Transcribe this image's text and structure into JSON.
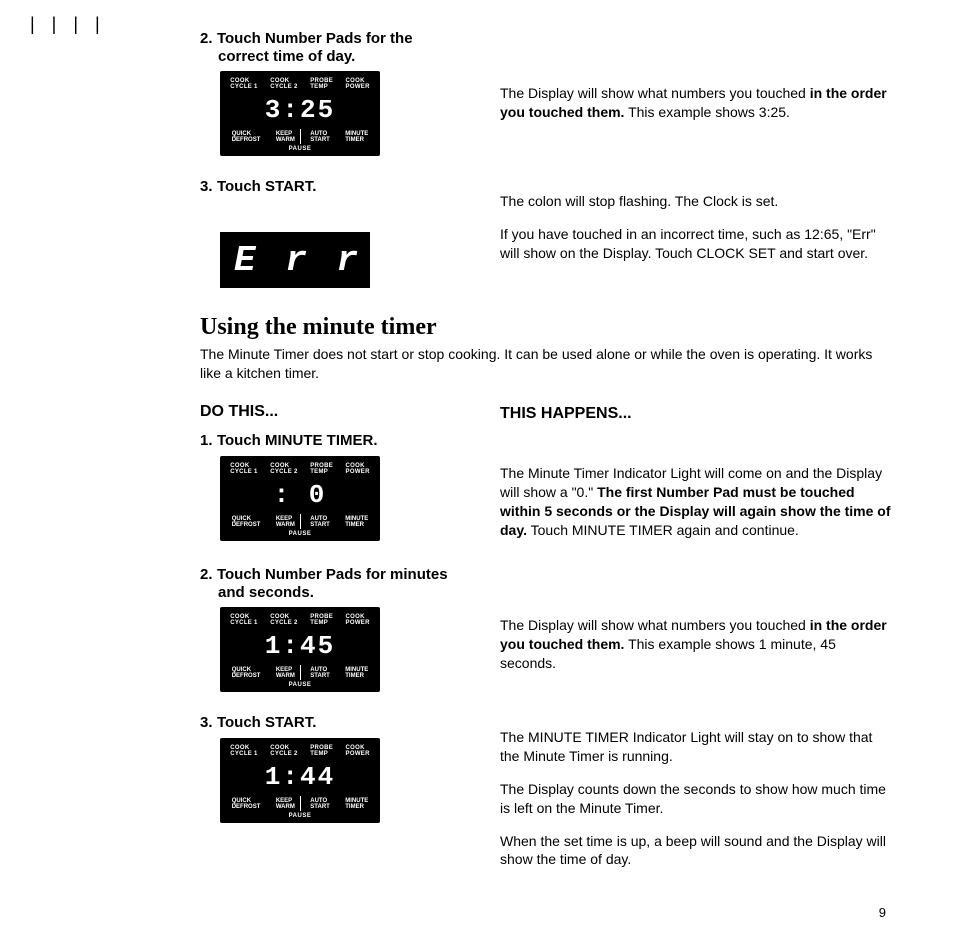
{
  "ticks": "|   | | |",
  "display_labels_top": {
    "a": "COOK\nCYCLE 1",
    "b": "COOK\nCYCLE 2",
    "c": "PROBE\nTEMP",
    "d": "COOK\nPOWER"
  },
  "display_labels_bottom": {
    "a": "QUICK\nDEFROST",
    "b": "KEEP\nWARM",
    "c": "AUTO\nSTART",
    "d": "MINUTE\nTIMER"
  },
  "display_pause": "PAUSE",
  "step2": {
    "num": "2.",
    "line1": "Touch Number Pads for the",
    "line2": "correct time of day.",
    "disp": "3:25",
    "explain_a": "The Display will show what numbers you touched ",
    "explain_bold": "in the order you touched them.",
    "explain_b": " This example shows 3:25."
  },
  "step3": {
    "num": "3.",
    "line1": "Touch START.",
    "disp": "E r r",
    "right1": "The colon will stop flashing. The Clock is set.",
    "right2": "If you have touched in an incorrect time, such as 12:65, \"Err\" will show on the Display. Touch CLOCK SET and start over."
  },
  "section_title": "Using the minute timer",
  "section_intro": "The Minute Timer does not start or stop cooking. It can be used alone or while the oven is operating. It works like a kitchen timer.",
  "col_do": "DO THIS...",
  "col_happens": "THIS HAPPENS...",
  "m1": {
    "num": "1.",
    "line1": "Touch MINUTE TIMER.",
    "disp": ":  0",
    "right_a": "The Minute Timer Indicator Light will come on and the Display will show a \"0.\" ",
    "right_bold": "The first Number Pad must be touched within 5 seconds or the Display will again show the time of day.",
    "right_b": " Touch MINUTE TIMER again and continue."
  },
  "m2": {
    "num": "2.",
    "line1": "Touch Number Pads for minutes",
    "line2": "and seconds.",
    "disp": "1:45",
    "right_a": "The Display will show what numbers you touched ",
    "right_bold": "in the order you touched them.",
    "right_b": " This example shows 1 minute, 45 seconds."
  },
  "m3": {
    "num": "3.",
    "line1": "Touch START.",
    "disp": "1:44",
    "right1": "The MINUTE TIMER Indicator Light will stay on to show that the Minute Timer is running.",
    "right2": "The Display counts down the seconds to show how much time is left on the Minute Timer.",
    "right3": "When the set time is up, a beep will sound and the Display will show the time of day."
  },
  "page_number": "9"
}
